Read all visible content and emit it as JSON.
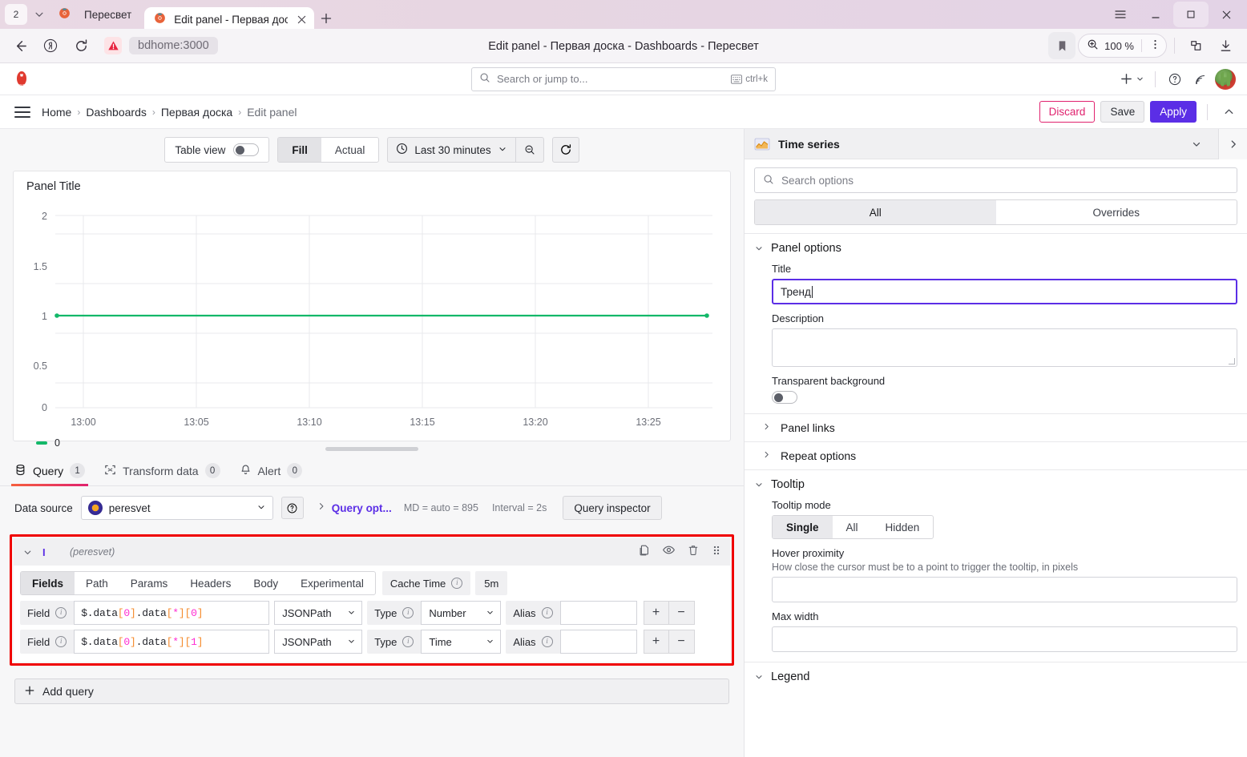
{
  "browser": {
    "tab_count": "2",
    "background_tab_title": "Пересвет",
    "active_tab_title": "Edit panel - Первая дос",
    "url": "bdhome:3000",
    "page_title": "Edit panel - Первая доска - Dashboards - Пересвет",
    "zoom_level": "100 %",
    "icons": {
      "back": "back-arrow-icon",
      "reload": "reload-icon",
      "warning": "warning-icon",
      "bookmark": "bookmark-icon",
      "zoom": "zoom-magnifier-icon",
      "more": "more-vertical-icon",
      "extensions": "extensions-icon",
      "downloads": "download-icon",
      "menu": "hamburger-menu-icon",
      "minimize": "minimize-icon",
      "maximize": "maximize-icon",
      "close": "close-icon",
      "new_tab": "plus-icon"
    }
  },
  "grafana": {
    "search": {
      "placeholder": "Search or jump to...",
      "shortcut": "ctrl+k"
    },
    "breadcrumb": [
      "Home",
      "Dashboards",
      "Первая доска",
      "Edit panel"
    ],
    "actions": {
      "discard": "Discard",
      "save": "Save",
      "apply": "Apply"
    },
    "toolbar": {
      "table_view_label": "Table view",
      "table_view_on": false,
      "fill_label": "Fill",
      "actual_label": "Actual",
      "fill_selected": true,
      "time_range": "Last 30 minutes"
    },
    "panel": {
      "title": "Panel Title",
      "legend_label": "0",
      "legend_color": "#13b869"
    },
    "tabs": [
      {
        "label": "Query",
        "count": "1",
        "active": true,
        "icon": "database-icon"
      },
      {
        "label": "Transform data",
        "count": "0",
        "active": false,
        "icon": "transform-icon"
      },
      {
        "label": "Alert",
        "count": "0",
        "active": false,
        "icon": "bell-icon"
      }
    ],
    "datasource": {
      "label": "Data source",
      "value": "peresvet",
      "query_options_label": "Query opt...",
      "max_data_points": "MD = auto = 895",
      "interval": "Interval = 2s",
      "query_inspector": "Query inspector"
    },
    "query_row": {
      "name": "I",
      "datasource": "(peresvet)",
      "tabs": [
        "Fields",
        "Path",
        "Params",
        "Headers",
        "Body",
        "Experimental"
      ],
      "active_tab": "Fields",
      "cache_time_label": "Cache Time",
      "cache_time_value": "5m",
      "actions": [
        "copy-icon",
        "eye-icon",
        "trash-icon",
        "drag-handle-icon"
      ],
      "fields": [
        {
          "label": "Field",
          "value_prefix": "$.data",
          "value": "$.data[0].data[*][0]",
          "language": "JSONPath",
          "type_label": "Type",
          "type": "Number",
          "alias_label": "Alias",
          "alias": "",
          "add": "+",
          "remove": "−"
        },
        {
          "label": "Field",
          "value": "$.data[0].data[*][1]",
          "language": "JSONPath",
          "type_label": "Type",
          "type": "Time",
          "alias_label": "Alias",
          "alias": "",
          "add": "+",
          "remove": "−"
        }
      ]
    },
    "add_query": "Add query",
    "options": {
      "viz_name": "Time series",
      "search_placeholder": "Search options",
      "tabs": {
        "all": "All",
        "overrides": "Overrides",
        "active": "All"
      },
      "panel_options": {
        "group": "Panel options",
        "title_label": "Title",
        "title_value": "Тренд",
        "description_label": "Description",
        "description_value": "",
        "transparent_label": "Transparent background",
        "transparent_on": false,
        "panel_links": "Panel links",
        "repeat_options": "Repeat options"
      },
      "tooltip": {
        "group": "Tooltip",
        "mode_label": "Tooltip mode",
        "modes": [
          "Single",
          "All",
          "Hidden"
        ],
        "mode_selected": "Single",
        "hover_label": "Hover proximity",
        "hover_desc": "How close the cursor must be to a point to trigger the tooltip, in pixels",
        "hover_value": "",
        "max_width_label": "Max width",
        "max_width_value": ""
      },
      "legend": {
        "group": "Legend"
      }
    }
  },
  "chart_data": {
    "type": "line",
    "title": "Panel Title",
    "xlabel": "",
    "ylabel": "",
    "x_ticks": [
      "13:00",
      "13:05",
      "13:10",
      "13:15",
      "13:20",
      "13:25"
    ],
    "y_ticks": [
      "0",
      "0.5",
      "1",
      "1.5",
      "2"
    ],
    "ylim": [
      0,
      2
    ],
    "grid": true,
    "legend_position": "bottom",
    "series": [
      {
        "name": "0",
        "color": "#13b869",
        "x": [
          "12:58",
          "13:28"
        ],
        "values": [
          1,
          1
        ]
      }
    ]
  }
}
